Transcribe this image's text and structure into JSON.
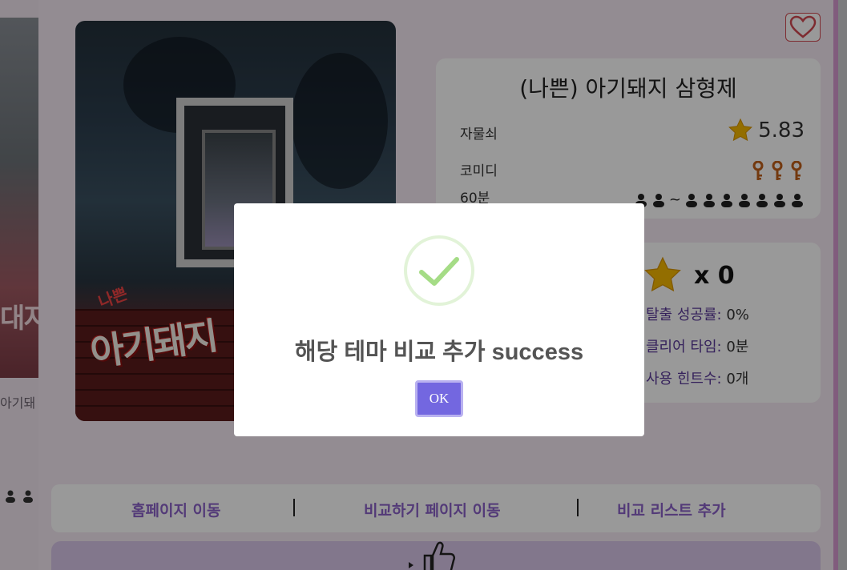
{
  "background": {
    "poster_text": "대지",
    "caption": "아기돼"
  },
  "theme": {
    "title": "(나쁜) 아기돼지 삼형제",
    "store": "자물쇠",
    "genre": "코미디",
    "duration": "60분",
    "rating": "5.83",
    "difficulty_keys": 3,
    "players_range": "~",
    "poster_title": "아기돼지",
    "poster_subtitle": "나쁜"
  },
  "stats": {
    "star_count": "x 0",
    "escape_rate_label": "탈출 성공률:",
    "escape_rate_value": "0%",
    "clear_time_label": "클리어 타임:",
    "clear_time_value": "0분",
    "hints_label": "사용 힌트수:",
    "hints_value": "0개"
  },
  "nav": {
    "homepage": "홈페이지 이동",
    "compare_page": "비교하기 페이지 이동",
    "add_compare": "비교 리스트 추가"
  },
  "modal": {
    "title": "해당 테마 비교 추가 success",
    "ok_label": "OK"
  },
  "colors": {
    "accent": "#7367e0",
    "nav_link": "#8a62c9",
    "success_check": "#a5dc86",
    "heart": "#d24a52"
  }
}
